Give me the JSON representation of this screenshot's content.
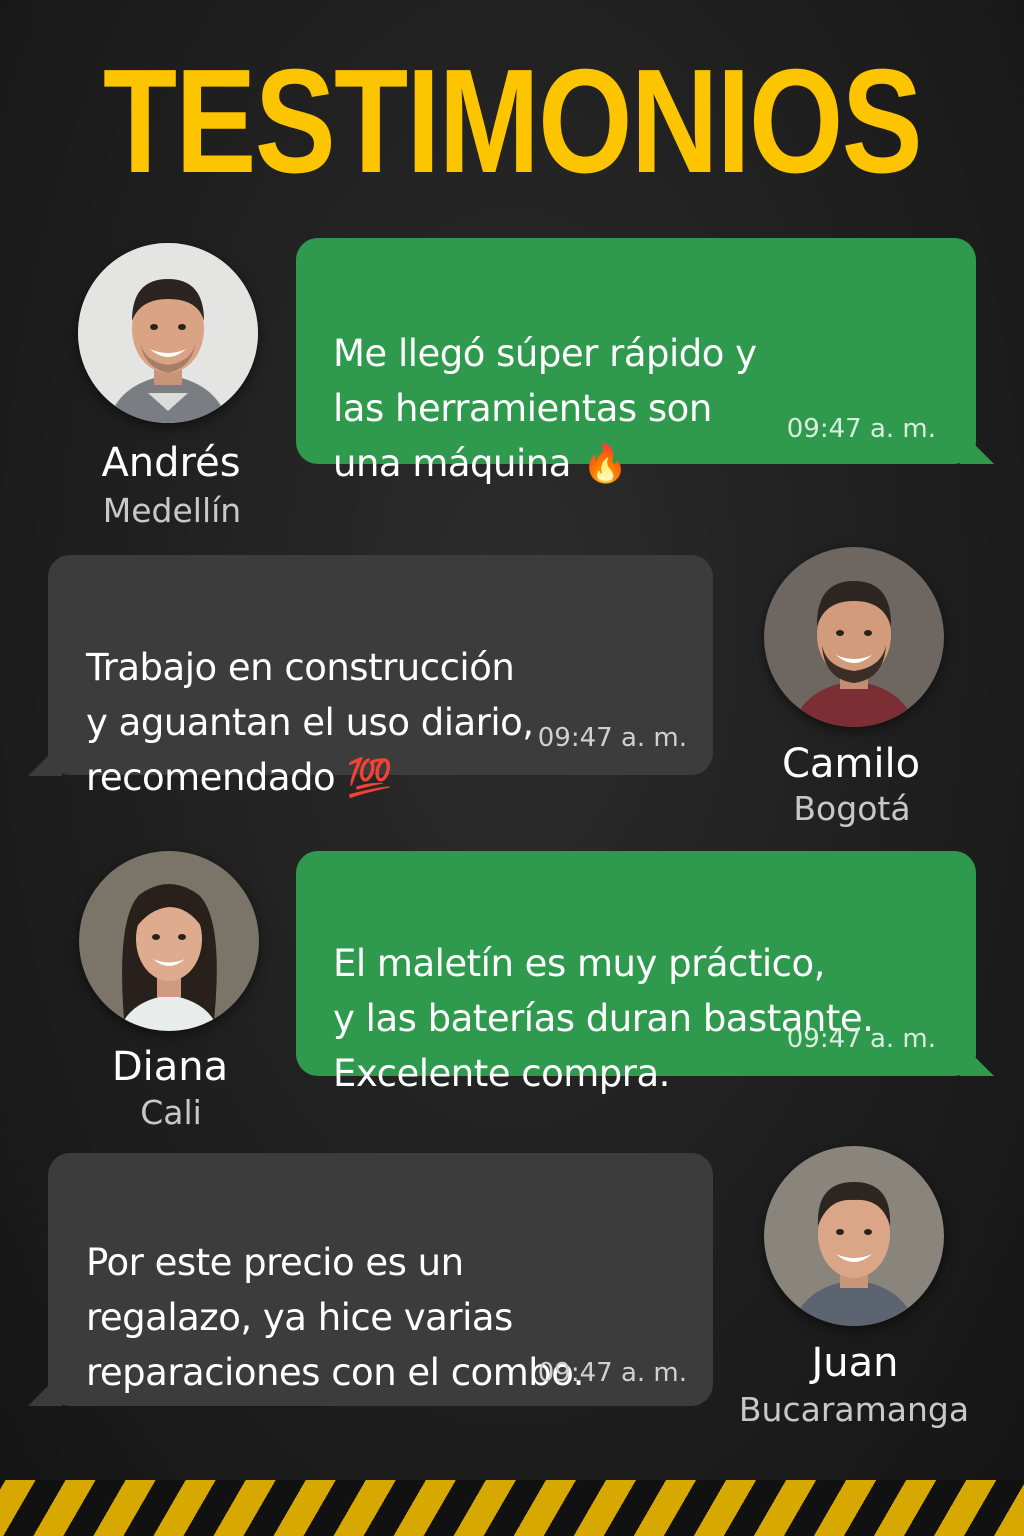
{
  "title": "TESTIMONIOS",
  "colors": {
    "accent": "#fdc400",
    "green_bubble": "#2f9a4d",
    "gray_bubble": "#3c3c3c",
    "background": "#1f1f1f"
  },
  "testimonials": [
    {
      "name": "Andrés",
      "city": "Medellín",
      "message": "Me llegó súper rápido y\nlas herramientas son\nuna máquina 🔥",
      "time": "09:47 a. m.",
      "bubble_style": "green",
      "avatar_icon": "man-avatar-icon"
    },
    {
      "name": "Camilo",
      "city": "Bogotá",
      "message": "Trabajo en construcción\ny aguantan el uso diario,\nrecomendado 💯",
      "time": "09:47 a. m.",
      "bubble_style": "gray",
      "avatar_icon": "man-avatar-icon"
    },
    {
      "name": "Diana",
      "city": "Cali",
      "message": "El maletín es muy práctico,\ny las baterías duran bastante.\nExcelente compra.",
      "time": "09:47 a. m.",
      "bubble_style": "green",
      "avatar_icon": "woman-avatar-icon"
    },
    {
      "name": "Juan",
      "city": "Bucaramanga",
      "message": "Por este precio es un\nregalazo, ya hice varias\nreparaciones con el combo.",
      "time": "09:47 a. m.",
      "bubble_style": "gray",
      "avatar_icon": "man-avatar-icon"
    }
  ]
}
